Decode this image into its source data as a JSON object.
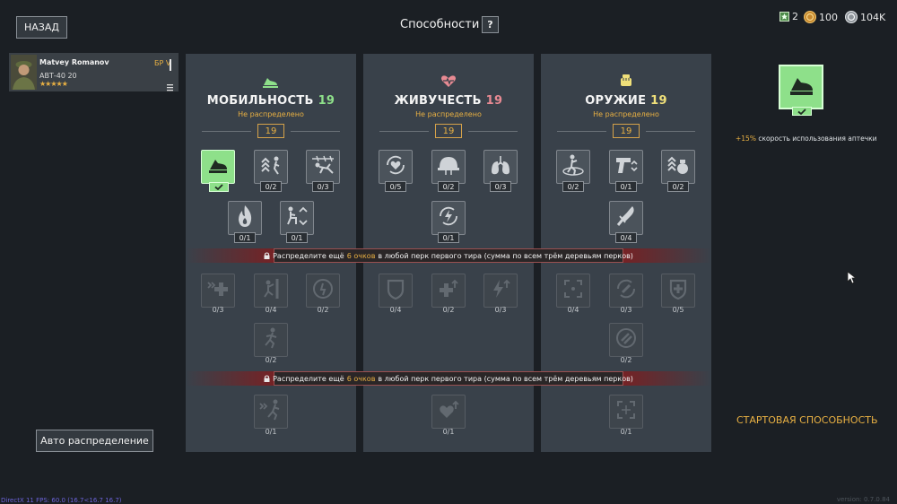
{
  "header": {
    "back_label": "НАЗАД",
    "title": "Способности",
    "help_label": "?",
    "currencies": [
      {
        "icon": "star-badge-icon",
        "value": "2"
      },
      {
        "icon": "gold-coin-icon",
        "value": "100"
      },
      {
        "icon": "silver-coin-icon",
        "value": "104K"
      }
    ]
  },
  "soldier": {
    "name": "Matvey Romanov",
    "rank": "БР V",
    "weapon": "АВТ-40 20",
    "stars": "★★★★★"
  },
  "auto_button": "Авто распределение",
  "panels": [
    {
      "title": "МОБИЛЬНОСТЬ",
      "level": "19",
      "unallocated": "Не распределено",
      "points": "19",
      "icon": "running-shoe-icon",
      "perks": [
        {
          "icon": "shoe-kick-icon",
          "count": ""
        },
        {
          "icon": "jump-arrows-icon",
          "count": "0/2"
        },
        {
          "icon": "crawl-barbed-wire-icon",
          "count": "0/3"
        },
        {
          "icon": "fire-resist-icon",
          "count": "0/1"
        },
        {
          "icon": "crouch-speed-icon",
          "count": "0/1"
        },
        {
          "icon": "sprint-heal-icon",
          "count": "0/3"
        },
        {
          "icon": "climb-icon",
          "count": "0/4"
        },
        {
          "icon": "stamina-icon",
          "count": "0/2"
        },
        {
          "icon": "run-icon",
          "count": "0/2"
        },
        {
          "icon": "fast-run-icon",
          "count": "0/1"
        }
      ]
    },
    {
      "title": "ЖИВУЧЕСТЬ",
      "level": "19",
      "unallocated": "Не распределено",
      "points": "19",
      "icon": "heart-pulse-icon",
      "perks": [
        {
          "icon": "heart-cycle-icon",
          "count": "0/5"
        },
        {
          "icon": "helmet-icon",
          "count": "0/2"
        },
        {
          "icon": "lungs-icon",
          "count": "0/3"
        },
        {
          "icon": "energy-cycle-icon",
          "count": "0/1"
        },
        {
          "icon": "shield-icon",
          "count": "0/4"
        },
        {
          "icon": "health-up-icon",
          "count": "0/2"
        },
        {
          "icon": "lightning-up-icon",
          "count": "0/3"
        },
        {
          "icon": "heart-up-icon",
          "count": "0/1"
        }
      ]
    },
    {
      "title": "ОРУЖИЕ",
      "level": "19",
      "unallocated": "Не распределено",
      "points": "19",
      "icon": "fist-icon",
      "perks": [
        {
          "icon": "throw-icon",
          "count": "0/2"
        },
        {
          "icon": "pistol-icon",
          "count": "0/1"
        },
        {
          "icon": "grenade-icon",
          "count": "0/2"
        },
        {
          "icon": "knife-icon",
          "count": "0/4"
        },
        {
          "icon": "crosshair-icon",
          "count": "0/4"
        },
        {
          "icon": "reload-cycle-icon",
          "count": "0/3"
        },
        {
          "icon": "shield-plus-icon",
          "count": "0/5"
        },
        {
          "icon": "ammo-icon",
          "count": "0/2"
        },
        {
          "icon": "focus-icon",
          "count": "0/1"
        }
      ]
    }
  ],
  "banner": {
    "prefix": "Распределите ещё",
    "points": "6 очков",
    "suffix": "в любой перк первого тира (сумма по всем трём деревьям перков)"
  },
  "selected": {
    "bonus_value": "+15%",
    "bonus_text": "скорость использования аптечки",
    "tag": "СТАРТОВАЯ СПОСОБНОСТЬ"
  },
  "footer": {
    "fps": "DirectX 11 FPS: 60.0 (16.7<16.7 16.7)",
    "version": "version: 0.7.0.84"
  },
  "colors": {
    "accent_green": "#8ee08a",
    "accent_gold": "#e8b043",
    "panel_bg": "#39414a"
  }
}
